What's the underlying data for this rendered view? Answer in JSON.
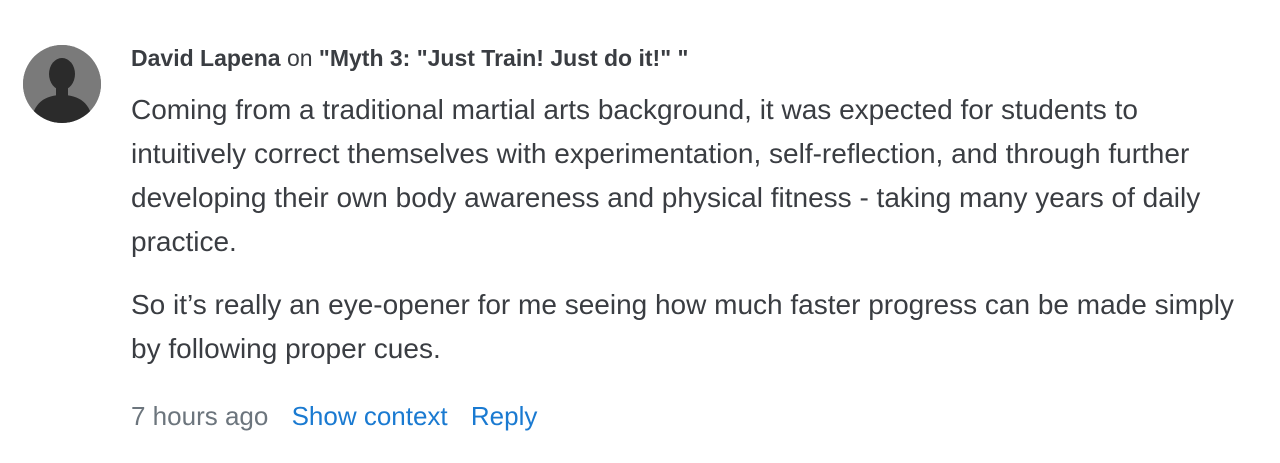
{
  "comment": {
    "author": "David Lapena",
    "on_word": "on",
    "title_open": "\"",
    "post_title": "Myth 3: \"Just Train! Just do it!\"",
    "title_close": " \"",
    "paragraphs": [
      "Coming from a traditional martial arts background, it was expected for students to intuitively correct themselves with experimentation, self-reflection, and through further developing their own body awareness and physical fitness - taking many years of daily practice.",
      "So it’s really an eye-opener for me seeing how much faster progress can be made simply by following proper cues."
    ],
    "timestamp": "7 hours ago",
    "show_context_label": "Show context",
    "reply_label": "Reply"
  },
  "avatar": {
    "icon": "default-user-silhouette-icon",
    "background": "#7a7a7a",
    "silhouette": "#2b2b2b"
  },
  "colors": {
    "text": "#3a3d42",
    "muted": "#6c757d",
    "link": "#1a7ad1"
  }
}
